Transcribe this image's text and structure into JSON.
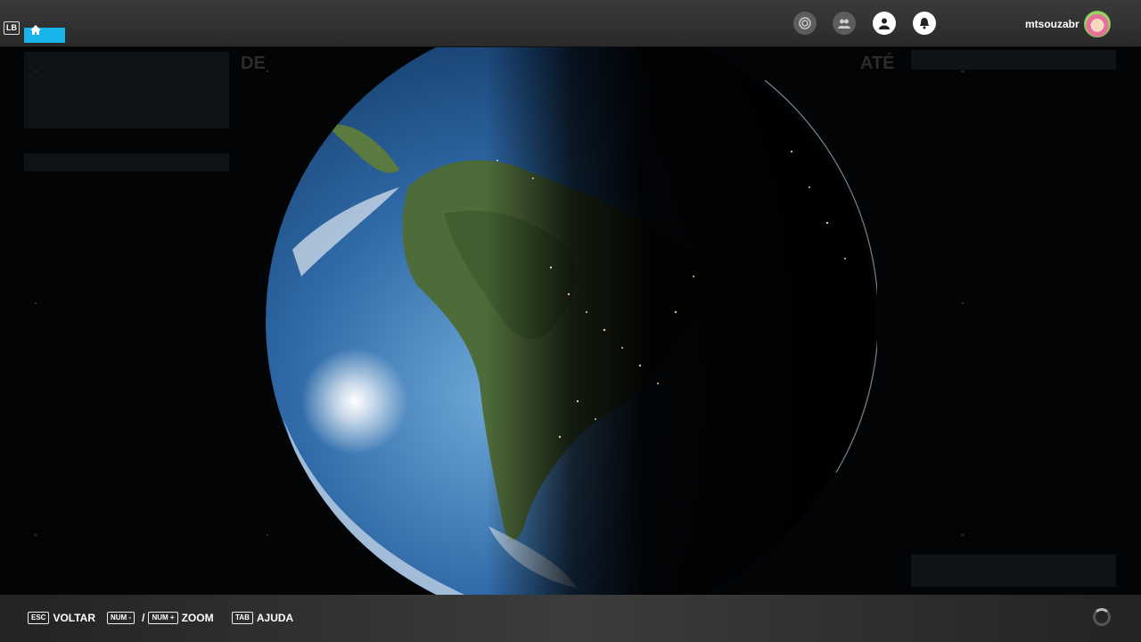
{
  "topbar": {
    "lb_key": "LB",
    "home_icon": "home-icon",
    "icons": [
      "activity-icon",
      "friends-icon",
      "profile-icon",
      "notification-icon"
    ],
    "username": "mtsouzabr",
    "accent_color": "#17b3ea"
  },
  "background_ui": {
    "from_label": "DE",
    "to_label": "ATÉ"
  },
  "bottombar": {
    "hints": [
      {
        "key": "ESC",
        "label": "VOLTAR"
      },
      {
        "key": "NUM -",
        "sep": "/",
        "key2": "NUM +",
        "label": "ZOOM"
      },
      {
        "key": "TAB",
        "label": "AJUDA"
      }
    ]
  }
}
